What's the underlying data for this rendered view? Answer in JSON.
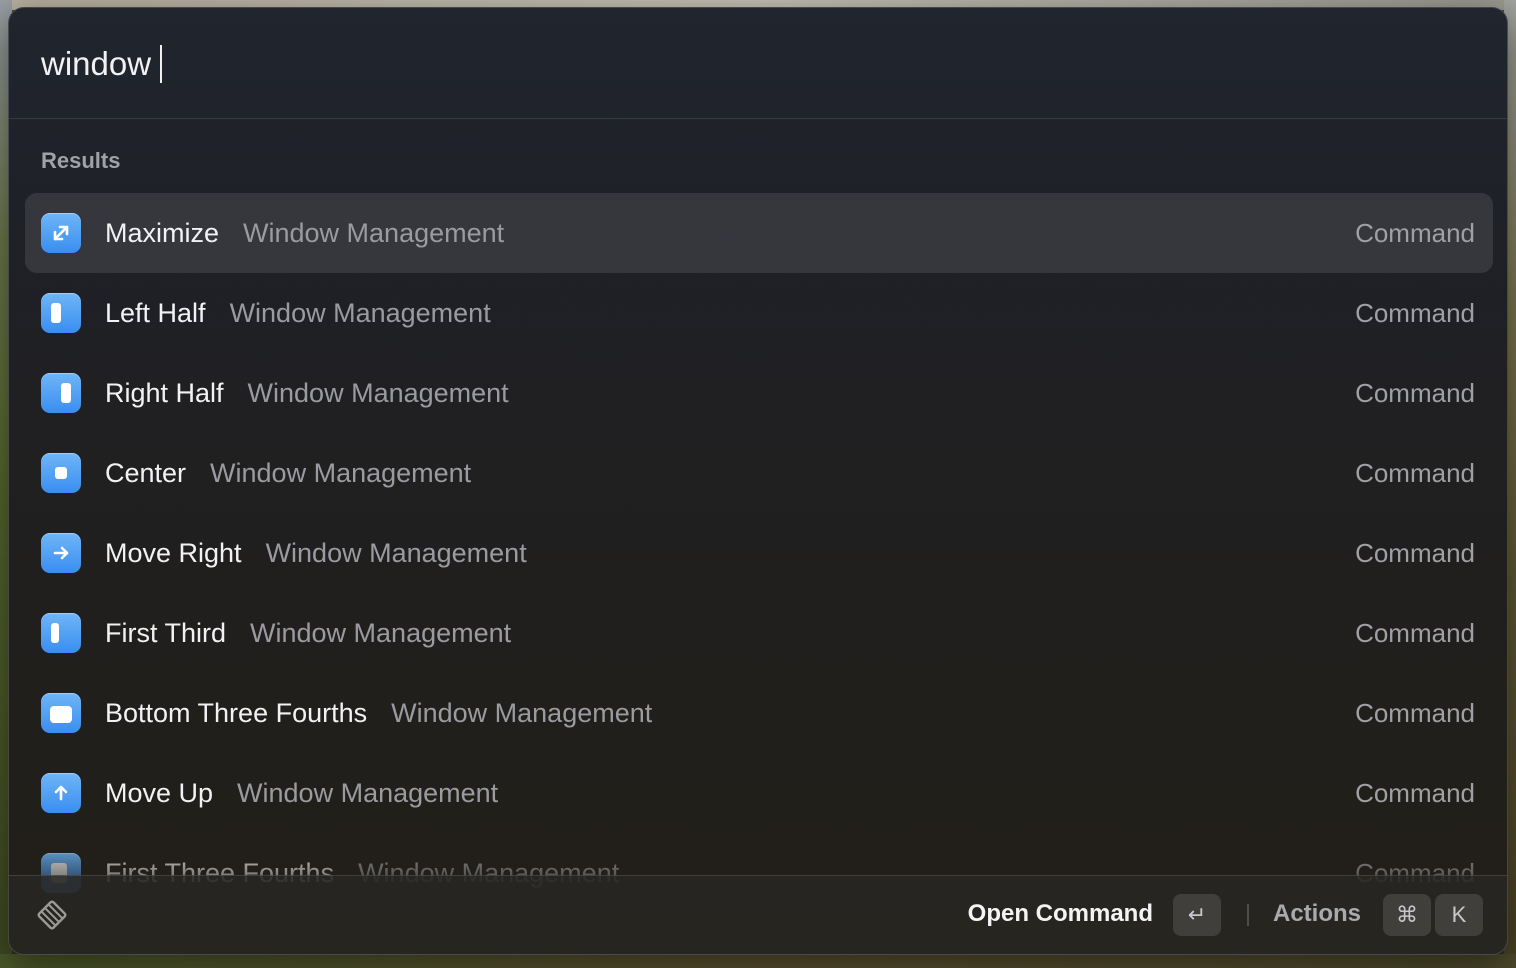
{
  "search": {
    "query": "window"
  },
  "section": {
    "label": "Results"
  },
  "results": [
    {
      "title": "Maximize",
      "subtitle": "Window Management",
      "type": "Command",
      "icon": "maximize-arrows-icon",
      "selected": true
    },
    {
      "title": "Left Half",
      "subtitle": "Window Management",
      "type": "Command",
      "icon": "left-half-icon"
    },
    {
      "title": "Right Half",
      "subtitle": "Window Management",
      "type": "Command",
      "icon": "right-half-icon"
    },
    {
      "title": "Center",
      "subtitle": "Window Management",
      "type": "Command",
      "icon": "center-icon"
    },
    {
      "title": "Move Right",
      "subtitle": "Window Management",
      "type": "Command",
      "icon": "arrow-right-icon"
    },
    {
      "title": "First Third",
      "subtitle": "Window Management",
      "type": "Command",
      "icon": "first-third-icon"
    },
    {
      "title": "Bottom Three Fourths",
      "subtitle": "Window Management",
      "type": "Command",
      "icon": "bottom-three-fourths-icon"
    },
    {
      "title": "Move Up",
      "subtitle": "Window Management",
      "type": "Command",
      "icon": "arrow-up-icon"
    },
    {
      "title": "First Three Fourths",
      "subtitle": "Window Management",
      "type": "Command",
      "icon": "first-three-fourths-icon"
    }
  ],
  "footer": {
    "primary_action": "Open Command",
    "primary_key": "↵",
    "secondary_action": "Actions",
    "secondary_key_modifier": "⌘",
    "secondary_key": "K",
    "logo_icon": "raycast-logo-icon"
  },
  "colors": {
    "icon_blue": "#3a8ef0",
    "text_primary": "#f2f2f4",
    "text_secondary": "#9a9ba0"
  }
}
